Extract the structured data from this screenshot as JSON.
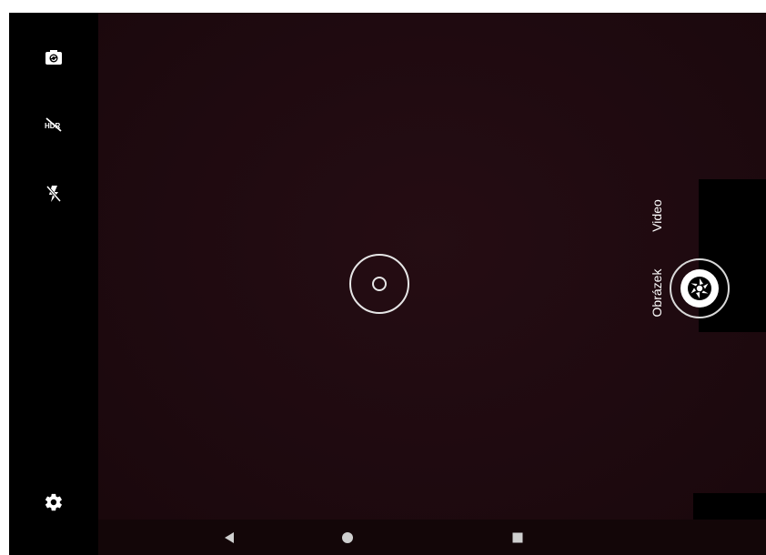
{
  "camera": {
    "modes": {
      "video_label": "Video",
      "picture_label": "Obrázek",
      "active": "Obrázek"
    },
    "left_controls": [
      {
        "icon": "switch-camera-icon"
      },
      {
        "icon": "hdr-off-icon"
      },
      {
        "icon": "flash-off-icon"
      },
      {
        "icon": "settings-gear-icon"
      }
    ],
    "shutter": {
      "icon": "shutter-aperture-icon"
    },
    "focus_indicator": {
      "icon": "focus-ring-icon"
    }
  },
  "navigation": {
    "buttons": [
      {
        "icon": "back-triangle-icon"
      },
      {
        "icon": "home-circle-icon"
      },
      {
        "icon": "recents-square-icon"
      }
    ]
  },
  "colors": {
    "viewfinder": "#1f0a10",
    "rail": "#000000",
    "foreground": "#ffffff"
  }
}
